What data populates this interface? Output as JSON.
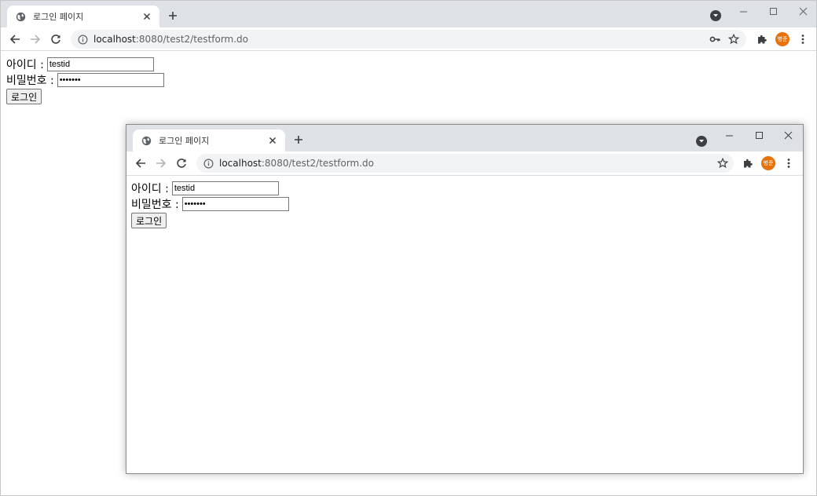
{
  "browser": {
    "tab_title": "로그인 페이지",
    "url_host": "localhost",
    "url_path": ":8080/test2/testform.do",
    "avatar_label": "병준",
    "avatar_color": "#e8710a"
  },
  "form": {
    "id_label": "아이디 :",
    "id_value": "testid",
    "pw_label": "비밀번호 :",
    "pw_value": "•••••••",
    "login_button": "로그인"
  },
  "popup": {
    "tab_title": "로그인 페이지",
    "url_host": "localhost",
    "url_path": ":8080/test2/testform.do",
    "avatar_label": "병준",
    "form": {
      "id_label": "아이디 :",
      "id_value": "testid",
      "pw_label": "비밀번호 :",
      "pw_value": "•••••••",
      "login_button": "로그인"
    }
  },
  "icons": {
    "favicon": "globe-icon",
    "tab_close": "close-icon",
    "new_tab": "plus-icon",
    "tab_search": "chevron-down-circle-icon",
    "back": "arrow-left-icon",
    "forward": "arrow-right-icon",
    "reload": "reload-icon",
    "site_info": "info-icon",
    "password_key": "key-icon",
    "bookmark": "star-icon",
    "extensions": "puzzle-icon",
    "menu": "kebab-menu-icon",
    "minimize": "minimize-icon",
    "maximize": "maximize-icon",
    "close_window": "close-window-icon"
  }
}
